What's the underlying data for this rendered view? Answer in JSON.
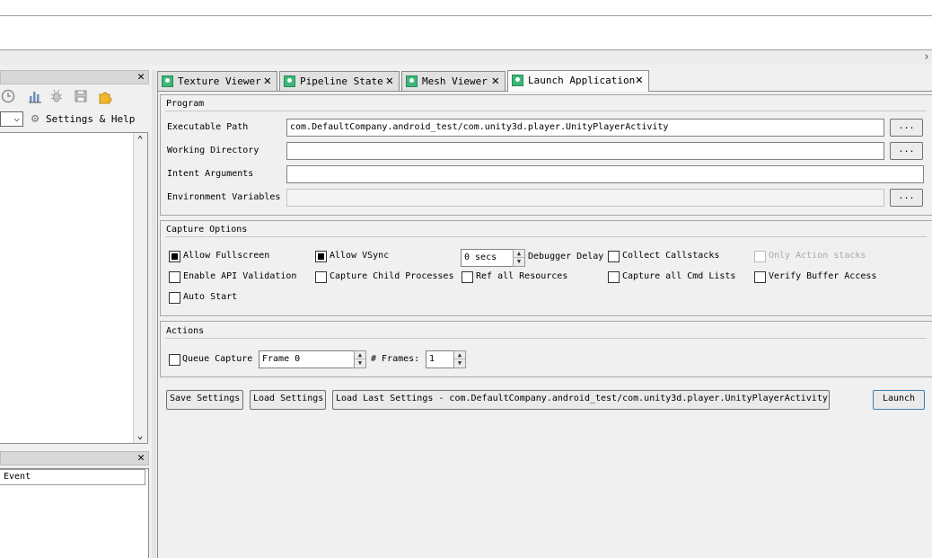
{
  "left_panel": {
    "toolbar_icons": [
      "clock-icon",
      "bar-chart-icon",
      "bug-icon",
      "save-icon",
      "puzzle-icon"
    ],
    "combo_arrow": "⌵",
    "settings_label": "Settings & Help"
  },
  "event_panel": {
    "column_header": "Event"
  },
  "tabs": [
    {
      "label": "Texture Viewer",
      "active": false
    },
    {
      "label": "Pipeline State",
      "active": false
    },
    {
      "label": "Mesh Viewer",
      "active": false
    },
    {
      "label": "Launch Application",
      "active": true
    }
  ],
  "program": {
    "title": "Program",
    "executable_path_label": "Executable Path",
    "executable_path_value": "com.DefaultCompany.android_test/com.unity3d.player.UnityPlayerActivity",
    "working_directory_label": "Working Directory",
    "working_directory_value": "",
    "intent_arguments_label": "Intent Arguments",
    "intent_arguments_value": "",
    "environment_variables_label": "Environment Variables",
    "environment_variables_value": "",
    "browse_label": "..."
  },
  "capture_options": {
    "title": "Capture Options",
    "allow_fullscreen": {
      "label": "Allow Fullscreen",
      "checked": true
    },
    "allow_vsync": {
      "label": "Allow VSync",
      "checked": true
    },
    "debugger_delay_value": "0 secs",
    "debugger_delay_label": "Debugger Delay",
    "collect_callstacks": {
      "label": "Collect Callstacks",
      "checked": false
    },
    "only_action_stacks": {
      "label": "Only Action stacks",
      "checked": false,
      "disabled": true
    },
    "enable_api_validation": {
      "label": "Enable API Validation",
      "checked": false
    },
    "capture_child_processes": {
      "label": "Capture Child Processes",
      "checked": false
    },
    "ref_all_resources": {
      "label": "Ref all Resources",
      "checked": false
    },
    "capture_all_cmd_lists": {
      "label": "Capture all Cmd Lists",
      "checked": false
    },
    "verify_buffer_access": {
      "label": "Verify Buffer Access",
      "checked": false
    },
    "auto_start": {
      "label": "Auto Start",
      "checked": false
    }
  },
  "actions": {
    "title": "Actions",
    "queue_capture_label": "Queue Capture",
    "queue_capture_checked": false,
    "frame_value": "Frame 0",
    "frames_label": "# Frames:",
    "frames_value": "1"
  },
  "buttons": {
    "save_settings": "Save Settings",
    "load_settings": "Load Settings",
    "load_last_settings": "Load Last Settings - com.DefaultCompany.android_test/com.unity3d.player.UnityPlayerActivity",
    "launch": "Launch"
  },
  "glyphs": {
    "close": "✕",
    "up": "⌃",
    "down": "⌄",
    "spin_up": "▲",
    "spin_down": "▼"
  },
  "colors": {
    "tab_icon": "#3cb878",
    "panel_bg": "#f0f0f0"
  }
}
